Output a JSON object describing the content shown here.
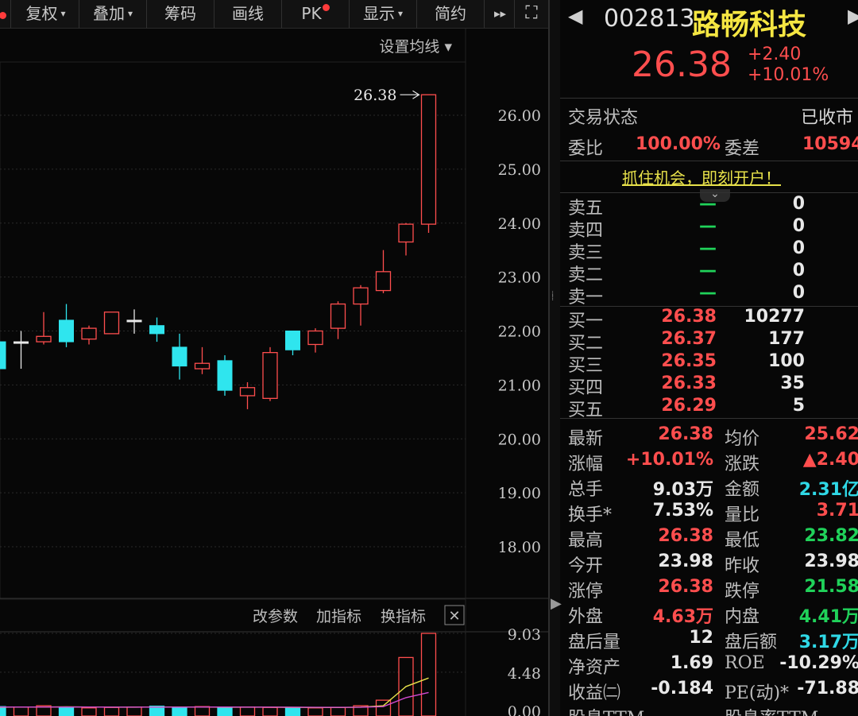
{
  "toolbar": {
    "items": [
      {
        "label": "复权",
        "caret": "▾"
      },
      {
        "label": "叠加",
        "caret": "▾"
      },
      {
        "label": "筹码",
        "caret": ""
      },
      {
        "label": "画线",
        "caret": ""
      },
      {
        "label": "PK",
        "caret": ""
      },
      {
        "label": "显示",
        "caret": "▾"
      },
      {
        "label": "简约",
        "caret": ""
      }
    ],
    "play_icon": "▸▸",
    "expand_icon": "⛶"
  },
  "main": {
    "ma_setting": "设置均线 ▾",
    "price_marker": "26.38",
    "sub_toolbar": {
      "edit_params": "改参数",
      "add_indicator": "加指标",
      "switch_indicator": "换指标",
      "close": "✕"
    }
  },
  "chart_data": {
    "type": "candlestick",
    "price_axis": {
      "ticks": [
        "26.00",
        "25.00",
        "24.00",
        "23.00",
        "22.00",
        "21.00",
        "20.00",
        "19.00",
        "18.00"
      ],
      "range": [
        17.6,
        26.4
      ]
    },
    "volume_axis": {
      "ticks": [
        "9.03",
        "4.48",
        "0.00"
      ],
      "range": [
        0,
        9.03
      ]
    },
    "candles": [
      {
        "o": 21.8,
        "h": 21.8,
        "l": 21.3,
        "c": 21.3
      },
      {
        "o": 21.8,
        "h": 22.0,
        "l": 21.3,
        "c": 21.8
      },
      {
        "o": 21.8,
        "h": 22.35,
        "l": 21.75,
        "c": 21.9
      },
      {
        "o": 22.2,
        "h": 22.5,
        "l": 21.7,
        "c": 21.8
      },
      {
        "o": 21.85,
        "h": 22.1,
        "l": 21.75,
        "c": 22.05
      },
      {
        "o": 21.95,
        "h": 22.35,
        "l": 21.95,
        "c": 22.35
      },
      {
        "o": 22.2,
        "h": 22.4,
        "l": 21.95,
        "c": 22.2
      },
      {
        "o": 22.1,
        "h": 22.25,
        "l": 21.8,
        "c": 21.95
      },
      {
        "o": 21.7,
        "h": 21.95,
        "l": 21.1,
        "c": 21.35
      },
      {
        "o": 21.3,
        "h": 21.7,
        "l": 21.2,
        "c": 21.4
      },
      {
        "o": 21.45,
        "h": 21.55,
        "l": 20.8,
        "c": 20.9
      },
      {
        "o": 20.8,
        "h": 21.05,
        "l": 20.55,
        "c": 20.95
      },
      {
        "o": 20.75,
        "h": 21.7,
        "l": 20.7,
        "c": 21.6
      },
      {
        "o": 22.0,
        "h": 22.0,
        "l": 21.55,
        "c": 21.65
      },
      {
        "o": 21.75,
        "h": 22.05,
        "l": 21.6,
        "c": 22.0
      },
      {
        "o": 22.05,
        "h": 22.55,
        "l": 21.85,
        "c": 22.5
      },
      {
        "o": 22.5,
        "h": 22.85,
        "l": 22.1,
        "c": 22.8
      },
      {
        "o": 22.75,
        "h": 23.5,
        "l": 22.7,
        "c": 23.1
      },
      {
        "o": 23.65,
        "h": 24.0,
        "l": 23.4,
        "c": 23.98
      },
      {
        "o": 23.98,
        "h": 26.38,
        "l": 23.82,
        "c": 26.38
      }
    ],
    "volumes": [
      0.35,
      0.45,
      0.4,
      0.55,
      0.4,
      0.3,
      0.35,
      0.4,
      0.5,
      0.4,
      0.45,
      0.35,
      0.4,
      0.35,
      0.3,
      0.3,
      0.35,
      0.55,
      1.2,
      6.2,
      9.03
    ],
    "ma_yellow": [
      0.35,
      0.38,
      0.4,
      0.4,
      0.42,
      0.4,
      0.38,
      0.38,
      0.4,
      0.4,
      0.4,
      0.38,
      0.38,
      0.38,
      0.36,
      0.34,
      0.34,
      0.38,
      0.55,
      2.8,
      3.8
    ],
    "ma_purple": [
      0.4,
      0.4,
      0.4,
      0.4,
      0.4,
      0.4,
      0.39,
      0.39,
      0.39,
      0.39,
      0.4,
      0.4,
      0.39,
      0.39,
      0.38,
      0.37,
      0.37,
      0.38,
      0.45,
      1.5,
      2.1
    ],
    "colors": {
      "up": "#ff4e4e",
      "down": "#2fe5ee",
      "neutral": "#e8e8e8",
      "ma1": "#e8e24a",
      "ma2": "#d24ad2"
    }
  },
  "quote": {
    "code": "002813",
    "name": "路畅科技",
    "price": "26.38",
    "change": "+2.40",
    "change_pct": "+10.01%",
    "trade_status_label": "交易状态",
    "trade_status": "已收市",
    "wei_bi_label": "委比",
    "wei_bi": "100.00%",
    "wei_cha_label": "委差",
    "wei_cha": "10594",
    "ad": "抓住机会，即刻开户！",
    "collapse_icon": "⌄",
    "asks": [
      {
        "label": "卖五",
        "price": "—",
        "vol": "0"
      },
      {
        "label": "卖四",
        "price": "—",
        "vol": "0"
      },
      {
        "label": "卖三",
        "price": "—",
        "vol": "0"
      },
      {
        "label": "卖二",
        "price": "—",
        "vol": "0"
      },
      {
        "label": "卖一",
        "price": "—",
        "vol": "0"
      }
    ],
    "bids": [
      {
        "label": "买一",
        "price": "26.38",
        "vol": "10277"
      },
      {
        "label": "买二",
        "price": "26.37",
        "vol": "177"
      },
      {
        "label": "买三",
        "price": "26.35",
        "vol": "100"
      },
      {
        "label": "买四",
        "price": "26.33",
        "vol": "35"
      },
      {
        "label": "买五",
        "price": "26.29",
        "vol": "5"
      }
    ],
    "stats": [
      {
        "l1": "最新",
        "v1": "26.38",
        "c1": "red",
        "l2": "均价",
        "v2": "25.62",
        "c2": "red"
      },
      {
        "l1": "涨幅",
        "v1": "+10.01%",
        "c1": "red",
        "l2": "涨跌",
        "v2": "▲2.40",
        "c2": "red"
      },
      {
        "l1": "总手",
        "v1": "9.03万",
        "c1": "wht",
        "l2": "金额",
        "v2": "2.31亿",
        "c2": "cyn"
      },
      {
        "l1": "换手*",
        "v1": "7.53%",
        "c1": "wht",
        "l2": "量比",
        "v2": "3.71",
        "c2": "red"
      },
      {
        "l1": "最高",
        "v1": "26.38",
        "c1": "red",
        "l2": "最低",
        "v2": "23.82",
        "c2": "grn"
      },
      {
        "l1": "今开",
        "v1": "23.98",
        "c1": "wht",
        "l2": "昨收",
        "v2": "23.98",
        "c2": "wht"
      },
      {
        "l1": "涨停",
        "v1": "26.38",
        "c1": "red",
        "l2": "跌停",
        "v2": "21.58",
        "c2": "grn"
      },
      {
        "l1": "外盘",
        "v1": "4.63万",
        "c1": "red",
        "l2": "内盘",
        "v2": "4.41万",
        "c2": "grn"
      },
      {
        "l1": "盘后量",
        "v1": "12",
        "c1": "wht",
        "l2": "盘后额",
        "v2": "3.17万",
        "c2": "cyn"
      },
      {
        "l1": "净资产",
        "v1": "1.69",
        "c1": "wht",
        "l2": "ROE",
        "v2": "-10.29%",
        "c2": "wht"
      },
      {
        "l1": "收益㈡",
        "v1": "-0.184",
        "c1": "wht",
        "l2": "PE(动)*",
        "v2": "-71.88",
        "c2": "wht"
      },
      {
        "l1": "股息TTM",
        "v1": "",
        "c1": "wht",
        "l2": "股息率TTM",
        "v2": "",
        "c2": "wht"
      }
    ]
  }
}
